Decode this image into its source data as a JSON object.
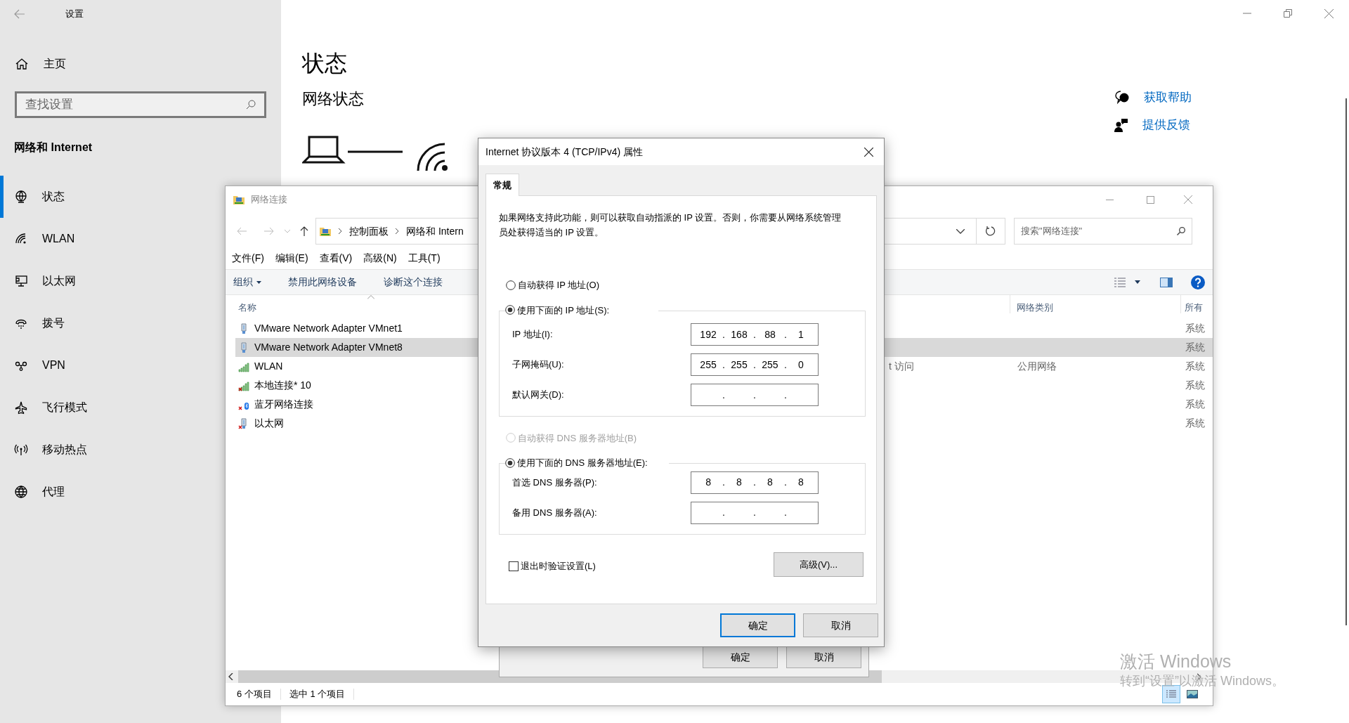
{
  "settings": {
    "title": "设置",
    "home": "主页",
    "search_placeholder": "查找设置",
    "section": "网络和 Internet",
    "nav": [
      {
        "label": "状态",
        "selected": true
      },
      {
        "label": "WLAN",
        "selected": false
      },
      {
        "label": "以太网",
        "selected": false
      },
      {
        "label": "拨号",
        "selected": false
      },
      {
        "label": "VPN",
        "selected": false
      },
      {
        "label": "飞行模式",
        "selected": false
      },
      {
        "label": "移动热点",
        "selected": false
      },
      {
        "label": "代理",
        "selected": false
      }
    ],
    "page_title": "状态",
    "subtitle": "网络状态",
    "links": [
      "获取帮助",
      "提供反馈"
    ]
  },
  "net_window": {
    "title": "网络连接",
    "breadcrumb": [
      "控制面板",
      "网络和 Intern"
    ],
    "search_placeholder": "搜索\"网络连接\"",
    "menu": [
      "文件(F)",
      "编辑(E)",
      "查看(V)",
      "高级(N)",
      "工具(T)"
    ],
    "commands": [
      {
        "label": "组织",
        "dropdown": true
      },
      {
        "label": "禁用此网络设备",
        "dropdown": false
      },
      {
        "label": "诊断这个连接",
        "dropdown": false
      }
    ],
    "columns": {
      "name": "名称",
      "network_category": "网络类别",
      "owner": "所有"
    },
    "rows": [
      {
        "name": "VMware Network Adapter VMnet1",
        "kind": "adapter",
        "disconnected": false,
        "selected": false,
        "owner": "系统"
      },
      {
        "name": "VMware Network Adapter VMnet8",
        "kind": "adapter",
        "disconnected": false,
        "selected": true,
        "owner": "系统"
      },
      {
        "name": "WLAN",
        "kind": "wireless",
        "disconnected": false,
        "selected": false,
        "column_2": "t 访问",
        "network_category": "公用网络",
        "owner": "系统"
      },
      {
        "name": "本地连接* 10",
        "kind": "wireless",
        "disconnected": true,
        "selected": false,
        "owner": "系统"
      },
      {
        "name": "蓝牙网络连接",
        "kind": "bluetooth",
        "disconnected": true,
        "selected": false,
        "owner": "系统"
      },
      {
        "name": "以太网",
        "kind": "adapter",
        "disconnected": true,
        "selected": false,
        "owner": "系统"
      }
    ],
    "status": [
      "6 个项目",
      "选中 1 个项目"
    ]
  },
  "back_dialog": {
    "buttons": [
      "确定",
      "取消"
    ]
  },
  "dialog": {
    "title": "Internet 协议版本 4 (TCP/IPv4) 属性",
    "tabs": [
      {
        "label": "常规",
        "selected": true
      }
    ],
    "intro": "如果网络支持此功能，则可以获取自动指派的 IP 设置。否则，你需要从网络系统管理员处获得适当的 IP 设置。",
    "separator": ".",
    "ip_auto": {
      "label": "自动获得 IP 地址(O)",
      "selected": false,
      "disabled": false
    },
    "ip_manual": {
      "label": "使用下面的 IP 地址(S):",
      "selected": true,
      "disabled": false
    },
    "ip_fields": [
      {
        "label": "IP 地址(I):",
        "octets": [
          "192",
          "168",
          "88",
          "1"
        ]
      },
      {
        "label": "子网掩码(U):",
        "octets": [
          "255",
          "255",
          "255",
          "0"
        ]
      },
      {
        "label": "默认网关(D):"
      }
    ],
    "dns_auto": {
      "label": "自动获得 DNS 服务器地址(B)",
      "selected": false,
      "disabled": true
    },
    "dns_manual": {
      "label": "使用下面的 DNS 服务器地址(E):",
      "selected": true,
      "disabled": false
    },
    "dns_fields": [
      {
        "label": "首选 DNS 服务器(P):",
        "octets": [
          "8",
          "8",
          "8",
          "8"
        ]
      },
      {
        "label": "备用 DNS 服务器(A):"
      }
    ],
    "validate": {
      "label": "退出时验证设置(L)",
      "checked": false
    },
    "advanced": "高级(V)...",
    "buttons": [
      "确定",
      "取消"
    ]
  },
  "watermark": [
    "激活 Windows",
    "转到“设置”以激活 Windows。"
  ]
}
